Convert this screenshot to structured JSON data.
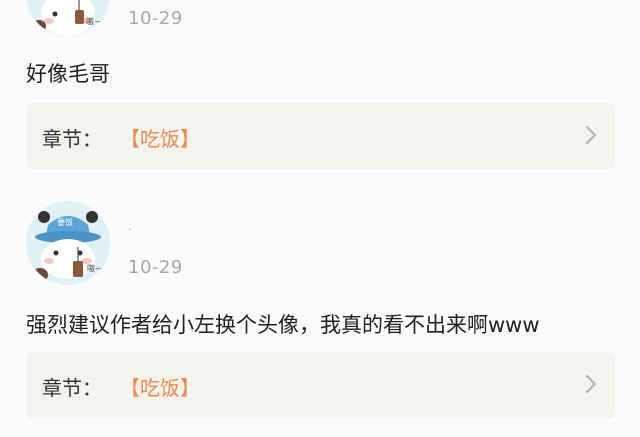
{
  "comments": [
    {
      "username": "",
      "date": "10-29",
      "text": "好像毛哥",
      "chapter_label": "章节：",
      "chapter_title": "【吃饭】",
      "avatar": {
        "icon": "panda-bucket-hat-avatar-icon",
        "hat_text": ""
      }
    },
    {
      "username": "·",
      "date": "10-29",
      "text": "强烈建议作者给小左换个头像，我真的看不出来啊www",
      "chapter_label": "章节：",
      "chapter_title": "【吃饭】",
      "avatar": {
        "icon": "panda-bucket-hat-avatar-icon",
        "hat_text": "要饭"
      }
    }
  ],
  "colors": {
    "accent": "#ef8a4d",
    "card_bg": "#f3f3f0",
    "date": "#a8a8a8",
    "hat": "#5aa6d6"
  }
}
